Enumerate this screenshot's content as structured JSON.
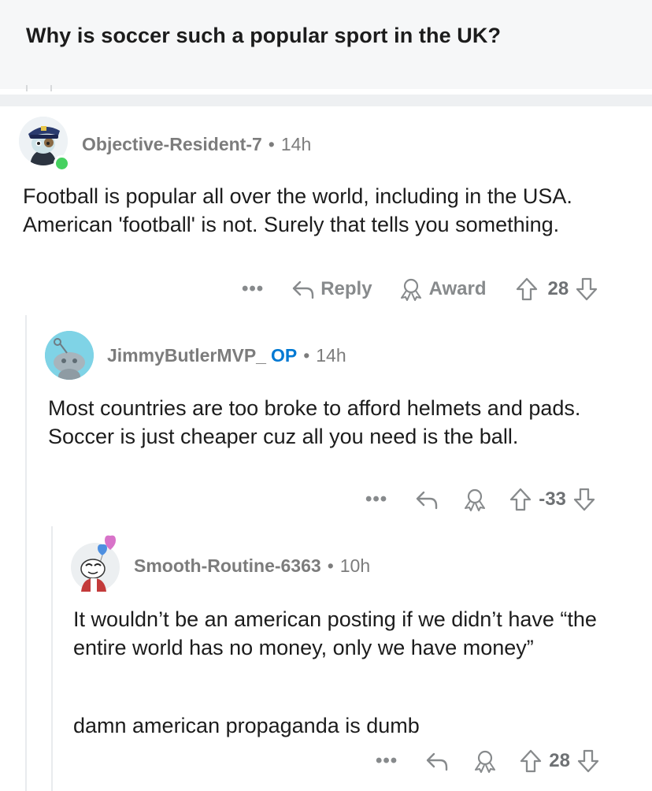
{
  "post": {
    "title": "Why is soccer such a popular sport in the UK?"
  },
  "comments": [
    {
      "username": "Objective-Resident-7",
      "time": "14h",
      "avatar": "snoo-police-hat-avatar",
      "text": "Football is popular all over the world, including in the USA. American 'football' is not. Surely that tells you something.",
      "actions": {
        "more": "•••",
        "reply": "Reply",
        "award": "Award",
        "score": "28"
      }
    },
    {
      "username": "JimmyButlerMVP_",
      "badge": "OP",
      "time": "14h",
      "avatar": "default-snoo-avatar",
      "text": "Most countries are too broke to afford helmets and pads. Soccer is just cheaper cuz all you need is the ball.",
      "actions": {
        "more": "•••",
        "score": "-33"
      }
    },
    {
      "username": "Smooth-Routine-6363",
      "time": "10h",
      "avatar": "snoo-heart-balloon-avatar",
      "text_p1": "It wouldn’t be an american posting if we didn’t have “the entire world has no money, only we have money”",
      "text_p2": "damn american propaganda is dumb",
      "actions": {
        "more": "•••",
        "score": "28"
      }
    }
  ],
  "colors": {
    "header_bg": "#f6f7f8",
    "meta": "#7c7c7c",
    "op": "#0079d3",
    "action": "#878a8c",
    "online": "#46d160"
  }
}
